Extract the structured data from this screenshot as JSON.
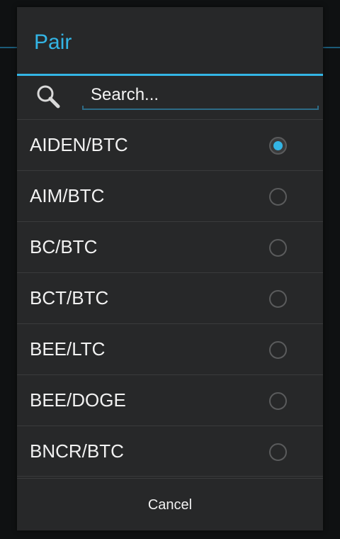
{
  "dialog": {
    "title": "Pair",
    "accent_color": "#33b5e5",
    "search": {
      "placeholder": "Search...",
      "value": ""
    },
    "items": [
      {
        "label": "AIDEN/BTC",
        "selected": true
      },
      {
        "label": "AIM/BTC",
        "selected": false
      },
      {
        "label": "BC/BTC",
        "selected": false
      },
      {
        "label": "BCT/BTC",
        "selected": false
      },
      {
        "label": "BEE/LTC",
        "selected": false
      },
      {
        "label": "BEE/DOGE",
        "selected": false
      },
      {
        "label": "BNCR/BTC",
        "selected": false
      }
    ],
    "cancel_label": "Cancel"
  },
  "icons": {
    "search": "search-icon",
    "radio_selected": "radio-checked-icon",
    "radio_unselected": "radio-unchecked-icon"
  }
}
